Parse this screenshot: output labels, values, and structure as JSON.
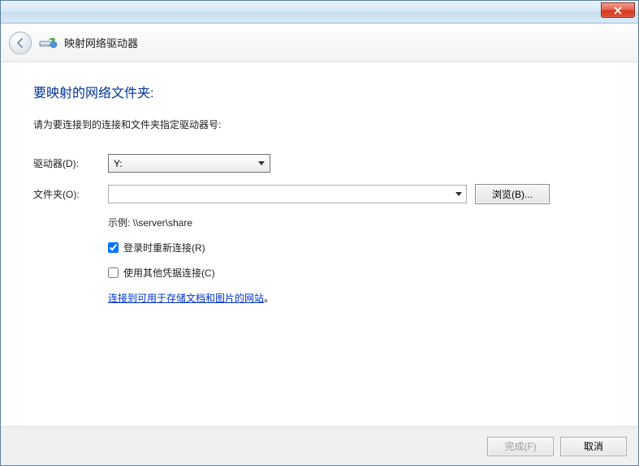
{
  "header": {
    "title": "映射网络驱动器"
  },
  "main": {
    "heading": "要映射的网络文件夹:",
    "instruction": "请为要连接到的连接和文件夹指定驱动器号:",
    "drive_label": "驱动器(D):",
    "drive_value": "Y:",
    "folder_label": "文件夹(O):",
    "folder_value": "",
    "browse_label": "浏览(B)...",
    "example": "示例: \\\\server\\share",
    "reconnect_label": "登录时重新连接(R)",
    "reconnect_checked": true,
    "credentials_label": "使用其他凭据连接(C)",
    "credentials_checked": false,
    "link_text": "连接到可用于存储文档和图片的网站",
    "link_suffix": "。"
  },
  "footer": {
    "finish_label": "完成(F)",
    "cancel_label": "取消"
  }
}
